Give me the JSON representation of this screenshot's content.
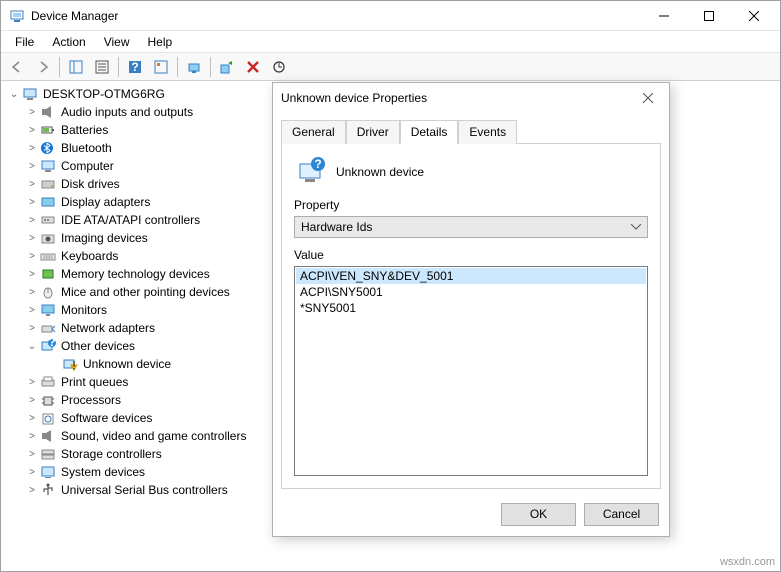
{
  "window": {
    "title": "Device Manager",
    "menus": [
      "File",
      "Action",
      "View",
      "Help"
    ]
  },
  "tree": {
    "root": "DESKTOP-OTMG6RG",
    "items": [
      "Audio inputs and outputs",
      "Batteries",
      "Bluetooth",
      "Computer",
      "Disk drives",
      "Display adapters",
      "IDE ATA/ATAPI controllers",
      "Imaging devices",
      "Keyboards",
      "Memory technology devices",
      "Mice and other pointing devices",
      "Monitors",
      "Network adapters",
      "Other devices",
      "Print queues",
      "Processors",
      "Software devices",
      "Sound, video and game controllers",
      "Storage controllers",
      "System devices",
      "Universal Serial Bus controllers"
    ],
    "otherDeviceChild": "Unknown device"
  },
  "dialog": {
    "title": "Unknown device Properties",
    "tabs": [
      "General",
      "Driver",
      "Details",
      "Events"
    ],
    "activeTab": "Details",
    "deviceName": "Unknown device",
    "propertyLabel": "Property",
    "propertySelected": "Hardware Ids",
    "valueLabel": "Value",
    "values": [
      "ACPI\\VEN_SNY&DEV_5001",
      "ACPI\\SNY5001",
      "*SNY5001"
    ],
    "okLabel": "OK",
    "cancelLabel": "Cancel"
  },
  "watermark": "wsxdn.com"
}
